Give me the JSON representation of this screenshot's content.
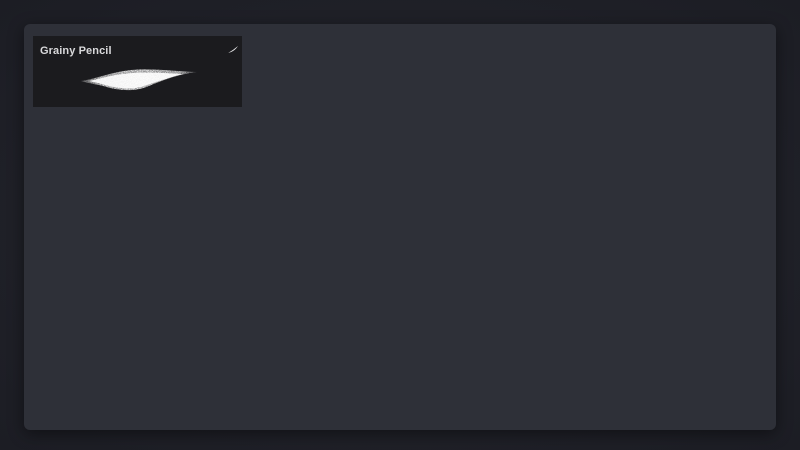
{
  "panel": {
    "brushes": [
      {
        "name": "Grainy Pencil",
        "icon": "brush-type-icon",
        "preview": "grainy-stroke-preview"
      }
    ]
  },
  "colors": {
    "background": "#1f2027",
    "panel": "#2e3038",
    "card": "#1b1b1e",
    "text": "#d9d9db",
    "stroke": "#ffffff"
  }
}
